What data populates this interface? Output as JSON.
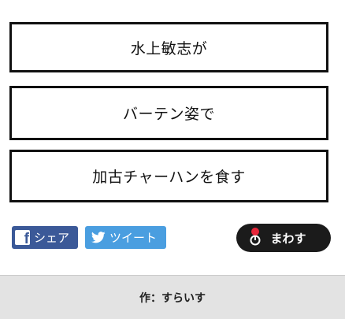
{
  "slots": [
    {
      "text": "水上敏志が"
    },
    {
      "text": "バーテン姿で"
    },
    {
      "text": "加古チャーハンを食す"
    }
  ],
  "share": {
    "facebook_label": "シェア",
    "twitter_label": "ツイート",
    "facebook_icon": "facebook-icon",
    "twitter_icon": "twitter-bird-icon"
  },
  "spin_button": {
    "label": "まわす",
    "icon": "lever-icon"
  },
  "footer": {
    "credit": "作：すらいす"
  },
  "colors": {
    "facebook": "#3b5998",
    "twitter": "#4a9ee0",
    "spin_bg": "#1b1b1b",
    "spin_knob": "#e8263a",
    "footer_bg": "#e3e3e3"
  }
}
